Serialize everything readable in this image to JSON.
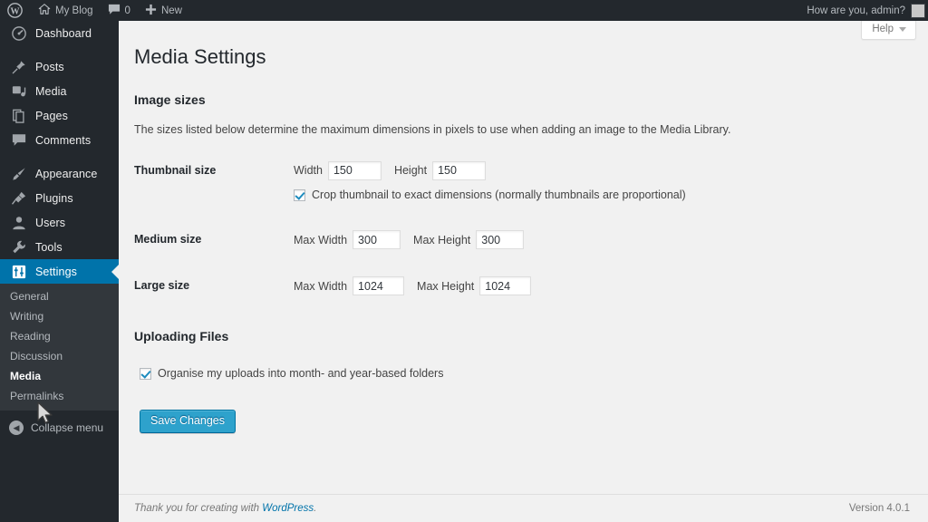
{
  "adminbar": {
    "logo_icon": "wordpress-logo-icon",
    "site_icon": "home-icon",
    "site_name": "My Blog",
    "comments_icon": "comment-bubble-icon",
    "comments_count": "0",
    "new_icon": "plus-icon",
    "new_label": "New",
    "greeting": "How are you, admin?",
    "avatar": "avatar"
  },
  "sidebar": {
    "items": [
      {
        "label": "Dashboard",
        "icon": "dashboard-icon",
        "name": "dashboard"
      },
      {
        "label": "Posts",
        "icon": "pin-icon",
        "name": "posts"
      },
      {
        "label": "Media",
        "icon": "media-icon",
        "name": "media"
      },
      {
        "label": "Pages",
        "icon": "page-icon",
        "name": "pages"
      },
      {
        "label": "Comments",
        "icon": "comment-bubble-icon",
        "name": "comments"
      },
      {
        "label": "Appearance",
        "icon": "paintbrush-icon",
        "name": "appearance"
      },
      {
        "label": "Plugins",
        "icon": "plug-icon",
        "name": "plugins"
      },
      {
        "label": "Users",
        "icon": "user-icon",
        "name": "users"
      },
      {
        "label": "Tools",
        "icon": "wrench-icon",
        "name": "tools"
      },
      {
        "label": "Settings",
        "icon": "settings-sliders-icon",
        "name": "settings"
      }
    ],
    "submenu": [
      {
        "label": "General",
        "name": "general"
      },
      {
        "label": "Writing",
        "name": "writing"
      },
      {
        "label": "Reading",
        "name": "reading"
      },
      {
        "label": "Discussion",
        "name": "discussion"
      },
      {
        "label": "Media",
        "name": "media"
      },
      {
        "label": "Permalinks",
        "name": "permalinks"
      }
    ],
    "active_item": "Settings",
    "active_submenu": "Media",
    "collapse_label": "Collapse menu",
    "collapse_icon": "arrow-left-circle-icon",
    "accent_color": "#0073aa"
  },
  "help_tab": {
    "label": "Help",
    "caret_icon": "chevron-down-icon"
  },
  "main": {
    "title": "Media Settings",
    "image_sizes": {
      "heading": "Image sizes",
      "description": "The sizes listed below determine the maximum dimensions in pixels to use when adding an image to the Media Library.",
      "rows": [
        {
          "name": "thumbnail",
          "label": "Thumbnail size",
          "fields": [
            {
              "label": "Width",
              "value": "150",
              "name": "thumbnail-width"
            },
            {
              "label": "Height",
              "value": "150",
              "name": "thumbnail-height"
            }
          ],
          "checkbox": {
            "label": "Crop thumbnail to exact dimensions (normally thumbnails are proportional)",
            "checked": true,
            "name": "crop-thumbnail"
          }
        },
        {
          "name": "medium",
          "label": "Medium size",
          "fields": [
            {
              "label": "Max Width",
              "value": "300",
              "name": "medium-max-width"
            },
            {
              "label": "Max Height",
              "value": "300",
              "name": "medium-max-height"
            }
          ]
        },
        {
          "name": "large",
          "label": "Large size",
          "fields": [
            {
              "label": "Max Width",
              "value": "1024",
              "name": "large-max-width"
            },
            {
              "label": "Max Height",
              "value": "1024",
              "name": "large-max-height"
            }
          ]
        }
      ]
    },
    "uploading_files": {
      "heading": "Uploading Files",
      "checkbox": {
        "label": "Organise my uploads into month- and year-based folders",
        "checked": true,
        "name": "organise-uploads"
      }
    },
    "save_label": "Save Changes",
    "primary_color": "#2ea2cc"
  },
  "footer": {
    "thanks_prefix": "Thank you for creating with ",
    "link_label": "WordPress",
    "thanks_suffix": ".",
    "version": "Version 4.0.1"
  }
}
